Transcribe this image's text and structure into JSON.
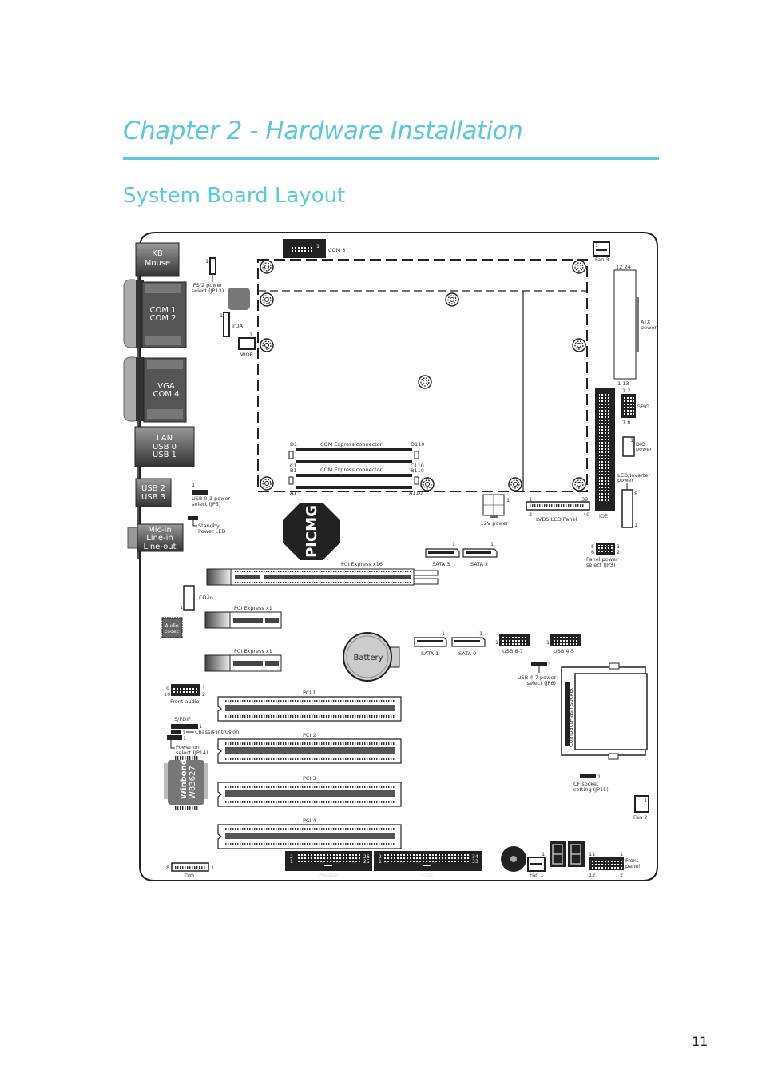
{
  "header": {
    "chapter_title": "Chapter 2 - Hardware Installation",
    "section_title": "System Board Layout"
  },
  "colors": {
    "accent": "#5bc8dc",
    "board_outline": "#222222",
    "connector_dark": "#222222",
    "port_gray": "#555555"
  },
  "rear_io": {
    "kb_mouse": [
      "KB",
      "Mouse"
    ],
    "com12": [
      "COM 1",
      "COM 2"
    ],
    "vga_com4": [
      "VGA",
      "COM 4"
    ],
    "lan_usb": [
      "LAN",
      "USB 0",
      "USB 1"
    ],
    "usb23": [
      "USB 2",
      "USB 3"
    ],
    "audio": [
      "Mic-in",
      "Line-in",
      "Line-out"
    ]
  },
  "labels": {
    "com3": "COM 3",
    "com3_pin": "1",
    "ps2_power": [
      "PS/2 power",
      "select (JP13)"
    ],
    "irda": "IrDA",
    "wor": "WOR",
    "fan3": "Fan 3",
    "atx_top": "12  24",
    "atx_bottom": "1    13",
    "atx_power": [
      "ATX",
      "power"
    ],
    "gpio": "GPIO",
    "gpio_top": "1 2",
    "gpio_bottom": "7 8",
    "dio_power": [
      "DIO",
      "power"
    ],
    "lcd_inverter": [
      "LCD/Inverter",
      "power"
    ],
    "ide": "IDE",
    "com_express_1": "COM Express connector",
    "com_express_2": "COM Express connector",
    "pins": {
      "d1": "D1",
      "d110": "D110",
      "c1": "C1",
      "c110": "C110",
      "b1": "B1",
      "b110": "B110",
      "a1": "A1",
      "a110": "A110"
    },
    "plus12v": "+12V power",
    "lvds": "LVDS LCD Panel",
    "lvds_pins": {
      "p1": "1",
      "p2": "2",
      "p39": "39",
      "p40": "40"
    },
    "usb03_power": [
      "USB 0-3 power",
      "select (JP5)"
    ],
    "standby_led": [
      "Standby",
      "Power LED"
    ],
    "picmg": "PICMG",
    "sata3": "SATA 3",
    "sata2": "SATA 2",
    "sata1": "SATA 1",
    "sata0": "SATA 0",
    "panel_power": [
      "Panel power",
      "select (JP3)"
    ],
    "pcie_x16": "PCI Express x16",
    "pcie_x1_a": "PCI Express x1",
    "pcie_x1_b": "PCI Express x1",
    "cd_in": "CD-in",
    "audio_codec": [
      "Audio",
      "codec"
    ],
    "battery": "Battery",
    "usb67": "USB 6-7",
    "usb45": "USB 4-5",
    "usb47_power": [
      "USB 4-7 power",
      "select (JP6)"
    ],
    "cf_socket": "CompactFlash socket",
    "cf_setting": [
      "CF socket",
      "setting (JP15)"
    ],
    "fan2": "Fan 2",
    "front_audio": "Front audio",
    "spdif": "S/PDIF",
    "chassis": "Chassis intrusion",
    "power_on": [
      "Power-on",
      "select (JP14)"
    ],
    "winbond": [
      "Winbond",
      "W83627"
    ],
    "pci1": "PCI 1",
    "pci2": "PCI 2",
    "pci3": "PCI 3",
    "pci4": "PCI 4",
    "dio": "DIO",
    "parallel": "Parallel",
    "parallel_pins": {
      "p2": "2",
      "p1": "1",
      "p26": "26",
      "p25": "25"
    },
    "fdd": "FDD",
    "fdd_pins": {
      "p2": "2",
      "p1": "1",
      "p34": "34",
      "p33": "33"
    },
    "fan1": "Fan 1",
    "front_panel": [
      "Front",
      "panel"
    ],
    "fp_pins": {
      "p11": "11",
      "p1": "1",
      "p12": "12",
      "p2": "2"
    },
    "fa_pins": {
      "p9": "9",
      "p10": "10",
      "p1": "1",
      "p2": "2"
    },
    "pin_one": "1",
    "pin_five": "5",
    "pin_six": "6",
    "pin_two": "2",
    "pin_eight": "8"
  },
  "footer": {
    "page_number": "11"
  }
}
